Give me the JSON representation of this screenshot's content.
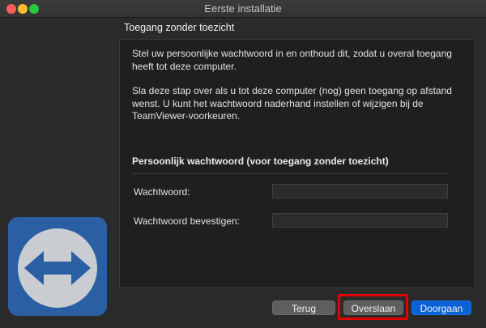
{
  "window": {
    "title": "Eerste installatie"
  },
  "section": {
    "title": "Toegang zonder toezicht"
  },
  "description": {
    "paragraph1": "Stel uw persoonlijke wachtwoord in en onthoud dit, zodat u overal toegang heeft tot deze computer.",
    "paragraph2": "Sla deze stap over als u tot deze computer (nog) geen toegang op afstand wenst. U kunt het wachtwoord naderhand instellen of wijzigen bij de TeamViewer-voorkeuren."
  },
  "password_group": {
    "title": "Persoonlijk wachtwoord (voor toegang zonder toezicht)",
    "password_label": "Wachtwoord:",
    "password_value": "",
    "confirm_label": "Wachtwoord bevestigen:",
    "confirm_value": ""
  },
  "buttons": {
    "back": "Terug",
    "skip": "Overslaan",
    "continue": "Doorgaan"
  },
  "logo": {
    "icon": "teamviewer-logo-icon"
  },
  "colors": {
    "accent": "#0a63d6",
    "highlight": "#e00000",
    "logo_background": "#2b5fa3"
  }
}
